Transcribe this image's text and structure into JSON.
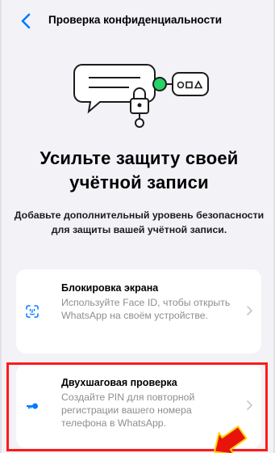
{
  "header": {
    "title": "Проверка конфиденциальности"
  },
  "main": {
    "headline_line1": "Усильте защиту своей",
    "headline_line2": "учётной записи",
    "subtext": "Добавьте дополнительный уровень безопасности для защиты вашей учётной записи."
  },
  "cards": [
    {
      "title": "Блокировка экрана",
      "description": "Используйте Face ID, чтобы открыть WhatsApp на своём устройстве.",
      "icon": "face-id-icon"
    },
    {
      "title": "Двухшаговая проверка",
      "description": "Создайте PIN для повторной регистрации вашего номера телефона в WhatsApp.",
      "icon": "key-icon"
    }
  ],
  "colors": {
    "accent": "#007aff",
    "highlight": "#ff1a1a",
    "annotation_arrow": "#e8140c",
    "illustration_green": "#25d366"
  }
}
